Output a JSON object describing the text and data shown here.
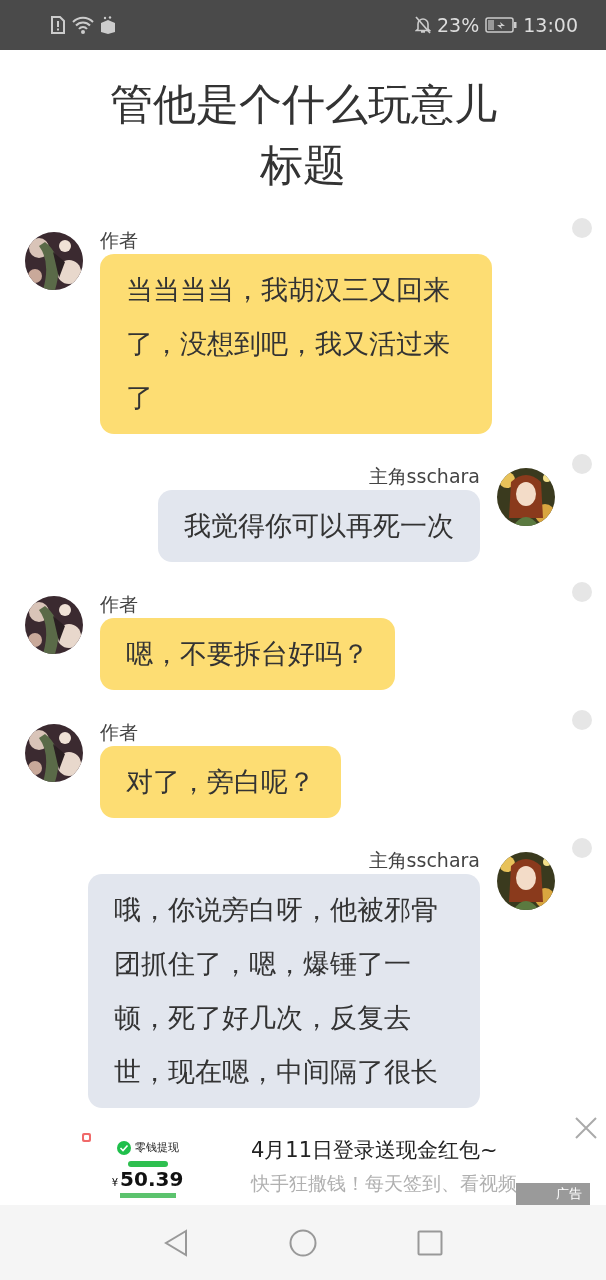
{
  "status_bar": {
    "battery_percent": "23%",
    "time": "13:00"
  },
  "title": {
    "lines": [
      "管他是个什么玩意儿",
      "标题"
    ]
  },
  "messages": [
    {
      "kind": "left",
      "sender": "作者",
      "text": "当当当当，我胡汉三又回来了，没想到吧，我又活过来了",
      "selected": false
    },
    {
      "kind": "right",
      "sender": "主角sschara",
      "text": "我觉得你可以再死一次",
      "selected": false
    },
    {
      "kind": "left",
      "sender": "作者",
      "text": "嗯，不要拆台好吗？",
      "selected": false
    },
    {
      "kind": "left",
      "sender": "作者",
      "text": "对了，旁白呢？",
      "selected": false
    },
    {
      "kind": "right",
      "sender": "主角sschara",
      "text": "哦，你说旁白呀，他被邪骨团抓住了，嗯，爆锤了一顿，死了好几次，反复去世，现在嗯，中间隔了很长",
      "selected": false
    }
  ],
  "ad": {
    "thumbnail": {
      "label": "零钱提现",
      "currency": "¥",
      "amount": "50.39"
    },
    "title": "4月11日登录送现金红包~",
    "description": "快手狂撒钱！每天签到、看视频",
    "badge": "广告"
  }
}
